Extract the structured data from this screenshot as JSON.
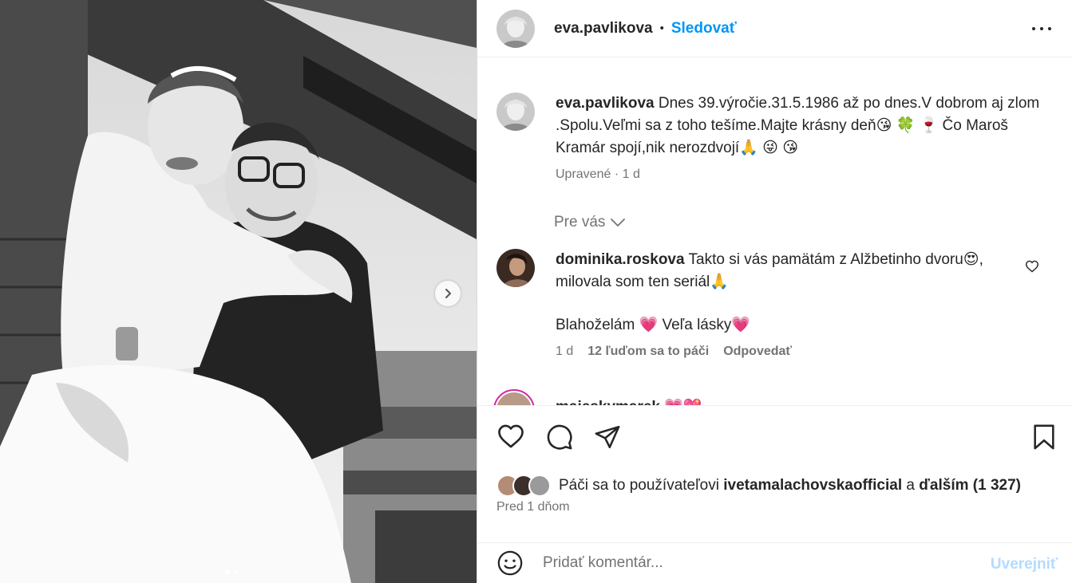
{
  "photo": {
    "alt": "",
    "carousel_count": 2,
    "carousel_active": 0
  },
  "header": {
    "username": "eva.pavlikova",
    "separator": "•",
    "follow_label": "Sledovať"
  },
  "caption": {
    "username": "eva.pavlikova",
    "text": "Dnes 39.výročie.31.5.1986 až po dnes.V dobrom aj zlom .Spolu.Veľmi sa z toho tešíme.Majte krásny deň😘 🍀 🍷 Čo Maroš Kramár spojí,nik nerozdvojí🙏 😜 😘",
    "edited": "Upravené",
    "dot": "·",
    "time": "1 d"
  },
  "section": {
    "for_you": "Pre vás"
  },
  "comment": {
    "username": "dominika.roskova",
    "text": "Takto si vás pamätám z Alžbetinho dvoru😍, milovala som ten seriál🙏",
    "text2": "Blahoželám 💗 Veľa lásky💗",
    "time": "1 d",
    "likes": "12 ľuďom sa to páči",
    "reply": "Odpovedať"
  },
  "next_comment": {
    "username": "majeskymarek 💗💖"
  },
  "likes": {
    "prefix": "Páči sa to používateľovi",
    "user": "ivetamalachovskaofficial",
    "and": "a",
    "others": "ďalším (1 327)"
  },
  "posted": "Pred 1 dňom",
  "composer": {
    "placeholder": "Pridať komentár...",
    "publish": "Uverejniť"
  },
  "colors": {
    "accent": "#0095f6",
    "muted": "#737373",
    "publish_disabled": "#b3dbff"
  }
}
